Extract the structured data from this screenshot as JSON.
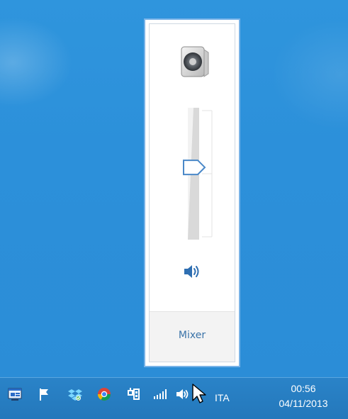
{
  "volume_flyout": {
    "device": "speakers-icon",
    "volume_level": 0.55,
    "mute_toggle_icon": "speaker-volume-icon",
    "mixer_label": "Mixer"
  },
  "taskbar": {
    "tray_icons": [
      "action-center-icon",
      "flag-icon",
      "dropbox-icon",
      "chrome-icon",
      "network-adapter-icon",
      "wifi-signal-icon",
      "speaker-volume-icon"
    ],
    "language": "ITA",
    "clock": {
      "time": "00:56",
      "date": "04/11/2013"
    }
  },
  "colors": {
    "desktop": "#2c90da",
    "taskbar": "#2478bb",
    "flyout_border": "#78b3e8",
    "mixer_text": "#3a73a8"
  }
}
